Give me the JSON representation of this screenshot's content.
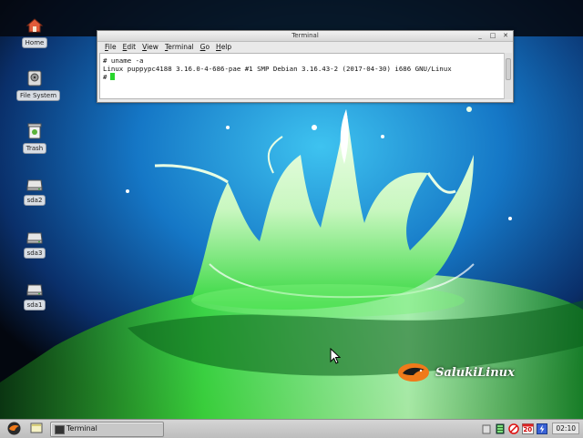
{
  "desktop": {
    "icons": [
      {
        "label": "Home"
      },
      {
        "label": "File System"
      },
      {
        "label": "Trash"
      },
      {
        "label": "sda2"
      },
      {
        "label": "sda3"
      },
      {
        "label": "sda1"
      }
    ]
  },
  "terminal": {
    "title": "Terminal",
    "menu": [
      {
        "accel": "F",
        "rest": "ile"
      },
      {
        "accel": "E",
        "rest": "dit"
      },
      {
        "accel": "V",
        "rest": "iew"
      },
      {
        "accel": "T",
        "rest": "erminal"
      },
      {
        "accel": "G",
        "rest": "o"
      },
      {
        "accel": "H",
        "rest": "elp"
      }
    ],
    "lines": [
      "# uname -a",
      "Linux puppypc4188 3.16.0-4-686-pae #1 SMP Debian 3.16.43-2 (2017-04-30) i686 GNU/Linux",
      "#"
    ],
    "cursor_color": "#29d62d"
  },
  "branding": {
    "text": "SalukiLinux"
  },
  "taskbar": {
    "task_label": "Terminal",
    "calendar_day": "20",
    "clock": "02:10"
  },
  "colors": {
    "accent_green": "#29d62d",
    "taskbar": "#c9c9c9"
  }
}
